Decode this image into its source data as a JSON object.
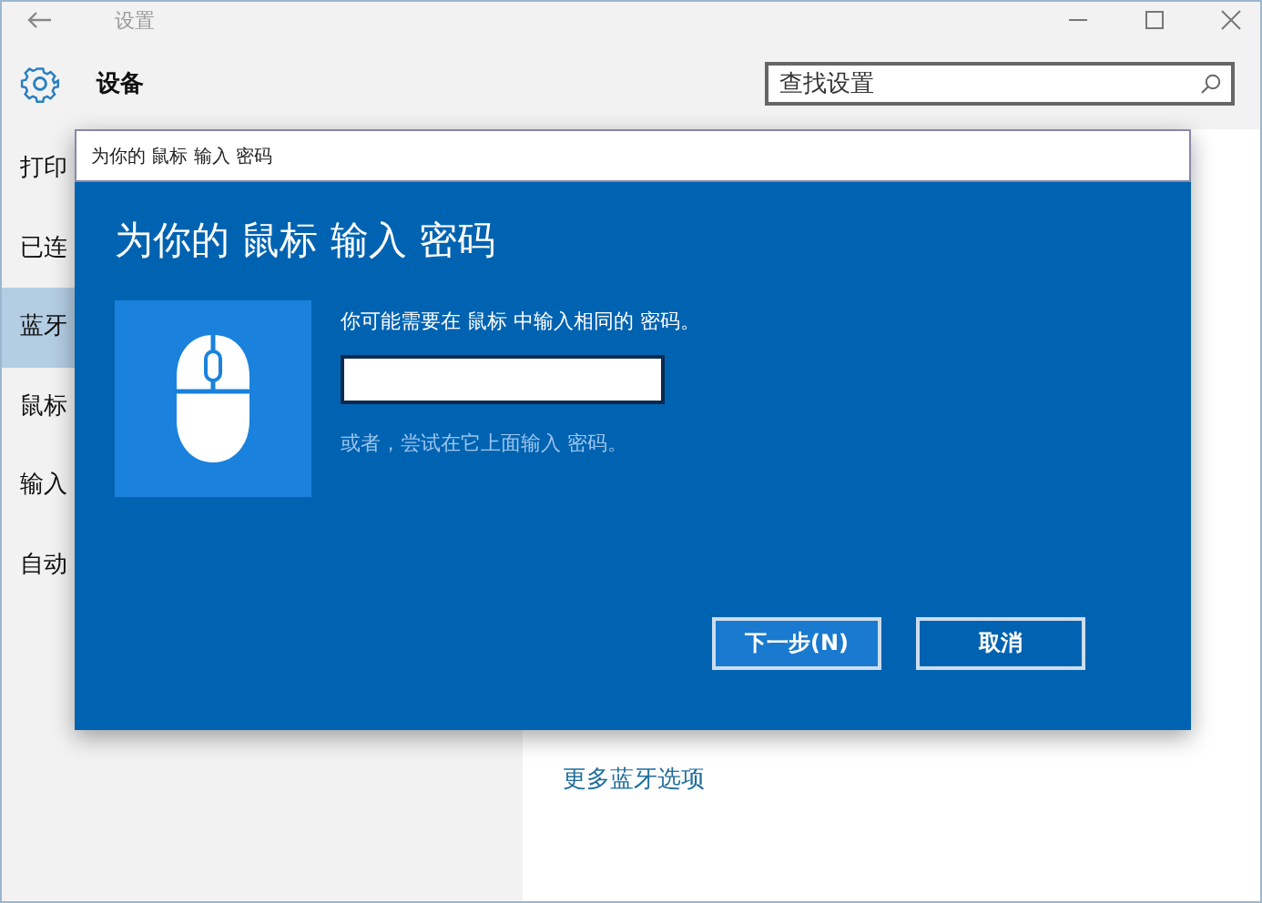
{
  "window": {
    "title": "设置"
  },
  "header": {
    "title": "设备",
    "search": {
      "placeholder": "查找设置"
    }
  },
  "sidebar": {
    "items": [
      {
        "label": "打印",
        "selected": false
      },
      {
        "label": "已连",
        "selected": false
      },
      {
        "label": "蓝牙",
        "selected": true
      },
      {
        "label": "鼠标",
        "selected": false
      },
      {
        "label": "输入",
        "selected": false
      },
      {
        "label": "自动",
        "selected": false
      }
    ]
  },
  "content": {
    "link": "更多蓝牙选项"
  },
  "dialog": {
    "title": "为你的 鼠标 输入 密码",
    "heading": "为你的 鼠标 输入 密码",
    "prompt": "你可能需要在 鼠标 中输入相同的 密码。",
    "alternative": "或者，尝试在它上面输入 密码。",
    "buttons": [
      {
        "label": "下一步(N)",
        "kind": "primary"
      },
      {
        "label": "取消",
        "kind": "secondary"
      }
    ]
  }
}
